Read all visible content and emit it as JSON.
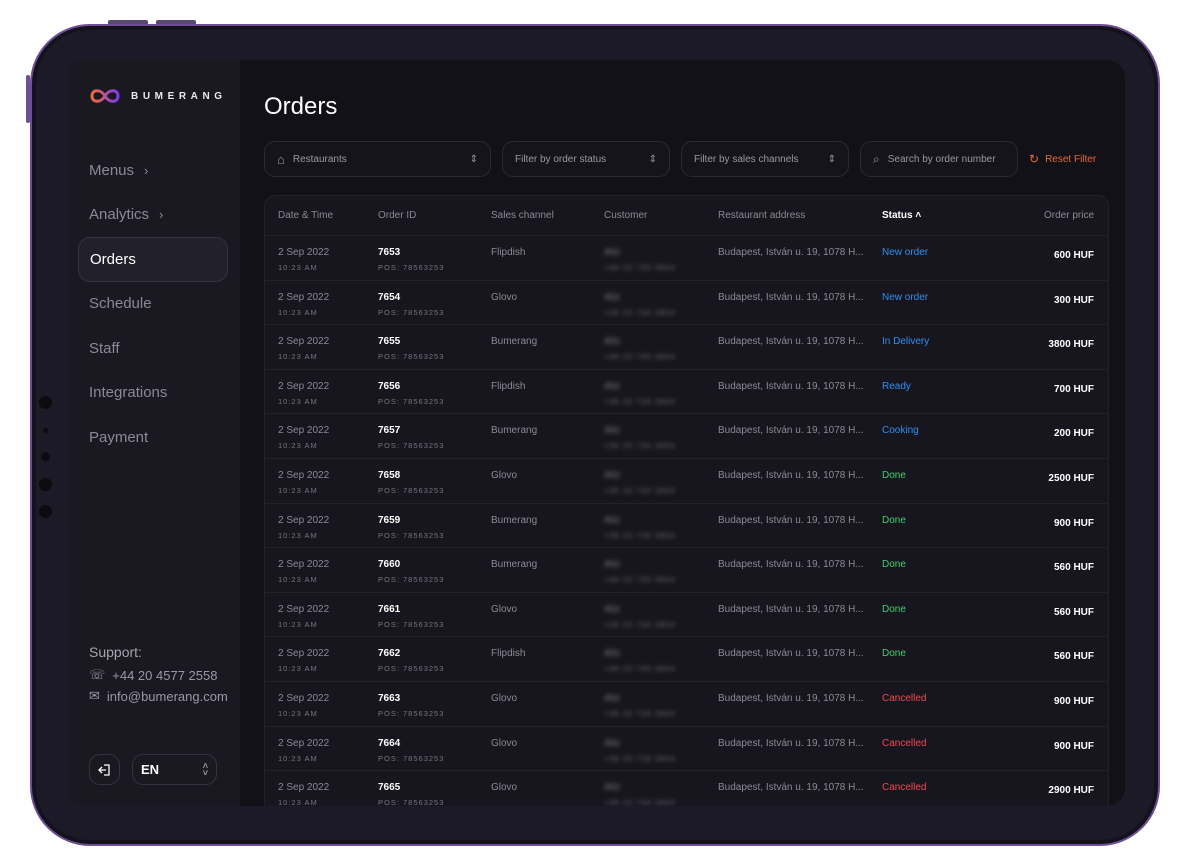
{
  "brand": "BUMERANG",
  "nav": [
    {
      "label": "Menus",
      "chevron": true
    },
    {
      "label": "Analytics",
      "chevron": true
    },
    {
      "label": "Orders",
      "active": true
    },
    {
      "label": "Schedule"
    },
    {
      "label": "Staff"
    },
    {
      "label": "Integrations"
    },
    {
      "label": "Payment"
    }
  ],
  "support": {
    "title": "Support:",
    "phone": "+44 20 4577 2558",
    "email": "info@bumerang.com"
  },
  "language": "EN",
  "page_title": "Orders",
  "filters": {
    "restaurants": "Restaurants",
    "order_status": "Filter by order status",
    "sales_channels": "Filter by sales channels",
    "search_placeholder": "Search by order number",
    "reset": "Reset Filter"
  },
  "columns": [
    "Date & Time",
    "Order ID",
    "Sales channel",
    "Customer",
    "Restaurant address",
    "Status",
    "Order price"
  ],
  "colors": {
    "accent": "#e36a3c",
    "blue": "#2f8ff0",
    "green": "#3ccf6e",
    "red": "#f0494f"
  },
  "orders": [
    {
      "date": "2 Sep 2022",
      "time": "10:23 AM",
      "id": "7653",
      "pos": "POS: 78563253",
      "channel": "Flipdish",
      "customer": "Aliz",
      "phone": "+36 20 730 3804",
      "address": "Budapest, István u. 19, 1078 H...",
      "status": "New order",
      "color": "#2f8ff0",
      "price": "600 HUF"
    },
    {
      "date": "2 Sep 2022",
      "time": "10:23 AM",
      "id": "7654",
      "pos": "POS: 78563253",
      "channel": "Glovo",
      "customer": "Aliz",
      "phone": "+36 20 730 3804",
      "address": "Budapest, István u. 19, 1078 H...",
      "status": "New order",
      "color": "#2f8ff0",
      "price": "300 HUF"
    },
    {
      "date": "2 Sep 2022",
      "time": "10:23 AM",
      "id": "7655",
      "pos": "POS: 78563253",
      "channel": "Bumerang",
      "customer": "Aliz",
      "phone": "+36 20 730 3804",
      "address": "Budapest, István u. 19, 1078 H...",
      "status": "In Delivery",
      "color": "#2f8ff0",
      "price": "3800 HUF"
    },
    {
      "date": "2 Sep 2022",
      "time": "10:23 AM",
      "id": "7656",
      "pos": "POS: 78563253",
      "channel": "Flipdish",
      "customer": "Aliz",
      "phone": "+36 20 730 3804",
      "address": "Budapest, István u. 19, 1078 H...",
      "status": "Ready",
      "color": "#2f8ff0",
      "price": "700 HUF"
    },
    {
      "date": "2 Sep 2022",
      "time": "10:23 AM",
      "id": "7657",
      "pos": "POS: 78563253",
      "channel": "Bumerang",
      "customer": "Aliz",
      "phone": "+36 20 730 3804",
      "address": "Budapest, István u. 19, 1078 H...",
      "status": "Cooking",
      "color": "#2f8ff0",
      "price": "200 HUF"
    },
    {
      "date": "2 Sep 2022",
      "time": "10:23 AM",
      "id": "7658",
      "pos": "POS: 78563253",
      "channel": "Glovo",
      "customer": "Aliz",
      "phone": "+36 20 730 3804",
      "address": "Budapest, István u. 19, 1078 H...",
      "status": "Done",
      "color": "#3ccf6e",
      "price": "2500 HUF"
    },
    {
      "date": "2 Sep 2022",
      "time": "10:23 AM",
      "id": "7659",
      "pos": "POS: 78563253",
      "channel": "Bumerang",
      "customer": "Aliz",
      "phone": "+36 20 730 3804",
      "address": "Budapest, István u. 19, 1078 H...",
      "status": "Done",
      "color": "#3ccf6e",
      "price": "900 HUF"
    },
    {
      "date": "2 Sep 2022",
      "time": "10:23 AM",
      "id": "7660",
      "pos": "POS: 78563253",
      "channel": "Bumerang",
      "customer": "Aliz",
      "phone": "+36 20 730 3804",
      "address": "Budapest, István u. 19, 1078 H...",
      "status": "Done",
      "color": "#3ccf6e",
      "price": "560 HUF"
    },
    {
      "date": "2 Sep 2022",
      "time": "10:23 AM",
      "id": "7661",
      "pos": "POS: 78563253",
      "channel": "Glovo",
      "customer": "Aliz",
      "phone": "+36 20 730 3804",
      "address": "Budapest, István u. 19, 1078 H...",
      "status": "Done",
      "color": "#3ccf6e",
      "price": "560 HUF"
    },
    {
      "date": "2 Sep 2022",
      "time": "10:23 AM",
      "id": "7662",
      "pos": "POS: 78563253",
      "channel": "Flipdish",
      "customer": "Aliz",
      "phone": "+36 20 730 3804",
      "address": "Budapest, István u. 19, 1078 H...",
      "status": "Done",
      "color": "#3ccf6e",
      "price": "560 HUF"
    },
    {
      "date": "2 Sep 2022",
      "time": "10:23 AM",
      "id": "7663",
      "pos": "POS: 78563253",
      "channel": "Glovo",
      "customer": "Aliz",
      "phone": "+36 20 730 3804",
      "address": "Budapest, István u. 19, 1078 H...",
      "status": "Cancelled",
      "color": "#f0494f",
      "price": "900 HUF"
    },
    {
      "date": "2 Sep 2022",
      "time": "10:23 AM",
      "id": "7664",
      "pos": "POS: 78563253",
      "channel": "Glovo",
      "customer": "Aliz",
      "phone": "+36 20 730 3804",
      "address": "Budapest, István u. 19, 1078 H...",
      "status": "Cancelled",
      "color": "#f0494f",
      "price": "900 HUF"
    },
    {
      "date": "2 Sep 2022",
      "time": "10:23 AM",
      "id": "7665",
      "pos": "POS: 78563253",
      "channel": "Glovo",
      "customer": "Aliz",
      "phone": "+36 20 730 3804",
      "address": "Budapest, István u. 19, 1078 H...",
      "status": "Cancelled",
      "color": "#f0494f",
      "price": "2900 HUF"
    }
  ]
}
